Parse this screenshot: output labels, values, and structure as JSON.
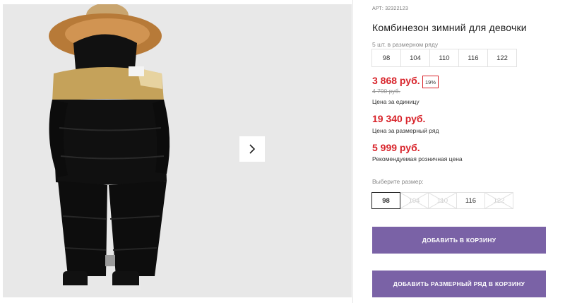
{
  "product": {
    "article_label": "АРТ:",
    "article": "32322123",
    "title": "Комбинезон зимний для девочки"
  },
  "size_row": {
    "label": "5 шт. в размерном ряду",
    "sizes": [
      "98",
      "104",
      "110",
      "116",
      "122"
    ]
  },
  "prices": {
    "current": "3 868 руб.",
    "discount": "19%",
    "old": "4 790 руб.",
    "unit_caption": "Цена за единицу",
    "row_price": "19 340 руб.",
    "row_caption": "Цена за размерный ряд",
    "retail_price": "5 999 руб.",
    "retail_caption": "Рекомендуемая розничная цена"
  },
  "size_select": {
    "label": "Выберите размер:",
    "options": [
      {
        "value": "98",
        "state": "selected"
      },
      {
        "value": "104",
        "state": "disabled"
      },
      {
        "value": "110",
        "state": "disabled"
      },
      {
        "value": "116",
        "state": "available"
      },
      {
        "value": "122",
        "state": "disabled"
      }
    ]
  },
  "buttons": {
    "add_to_cart": "ДОБАВИТЬ В КОРЗИНУ",
    "add_row_to_cart": "ДОБАВИТЬ РАЗМЕРНЫЙ РЯД В КОРЗИНУ"
  },
  "colors": {
    "accent": "#7a62a6",
    "price_red": "#d8232a"
  },
  "icons": {
    "next": "chevron-right-icon"
  }
}
